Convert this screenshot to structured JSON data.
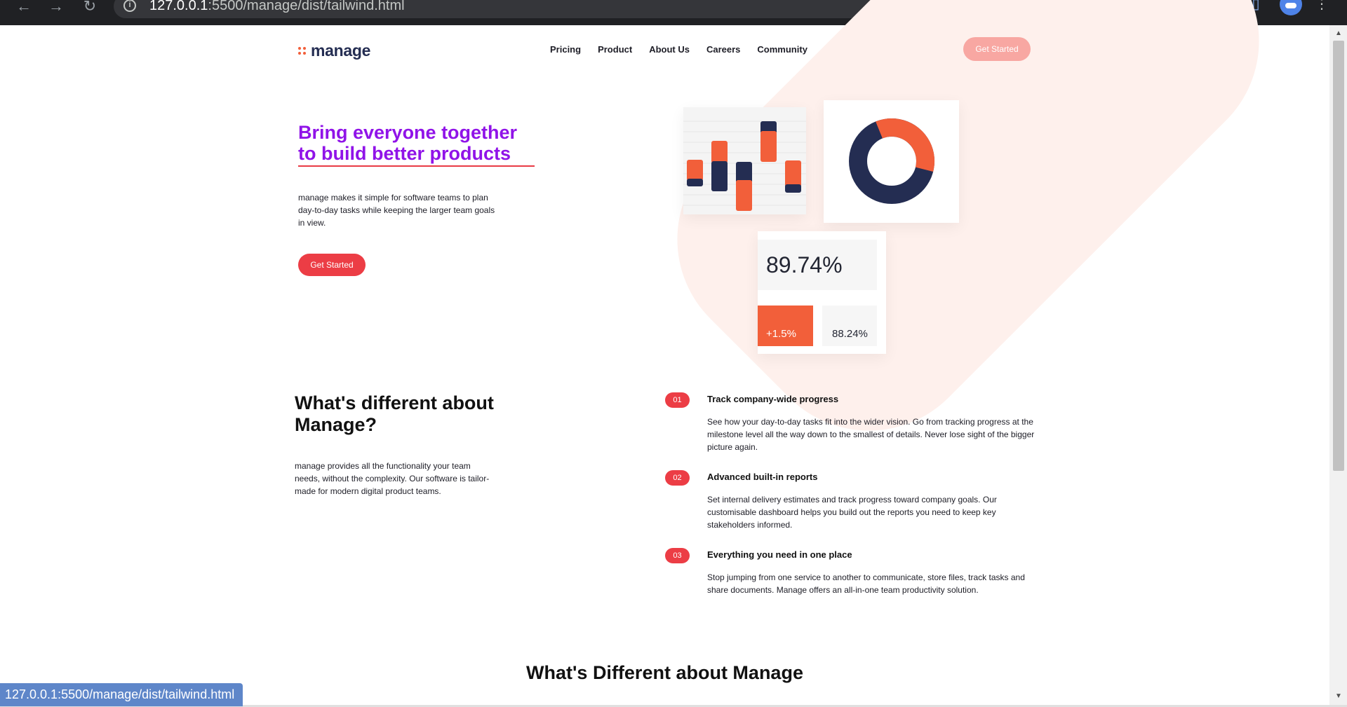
{
  "browser": {
    "url_host": "127.0.0.1",
    "url_path": ":5500/manage/dist/tailwind.html",
    "ext_badge": "{≡}",
    "status_url": "127.0.0.1:5500/manage/dist/tailwind.html"
  },
  "header": {
    "logo": "manage",
    "nav": [
      "Pricing",
      "Product",
      "About Us",
      "Careers",
      "Community"
    ],
    "cta_label": "Get Started"
  },
  "hero": {
    "title": "Bring everyone together to build better products",
    "description": "manage makes it simple for software teams to plan day-to-day tasks while keeping the larger team goals in view.",
    "cta_label": "Get Started"
  },
  "dashboard": {
    "main_stat": "89.74%",
    "change": "+1.5%",
    "secondary_stat": "88.24%",
    "colors": {
      "orange": "#f25f3a",
      "navy": "#242d52"
    },
    "donut_orange_fraction": 0.35
  },
  "features": {
    "title": "What's different about Manage?",
    "description": "manage provides all the functionality your team needs, without the complexity. Our software is tailor-made for modern digital product teams.",
    "items": [
      {
        "number": "01",
        "title": "Track company-wide progress",
        "description": "See how your day-to-day tasks fit into the wider vision. Go from tracking progress at the milestone level all the way down to the smallest of details. Never lose sight of the bigger picture again."
      },
      {
        "number": "02",
        "title": "Advanced built-in reports",
        "description": "Set internal delivery estimates and track progress toward company goals. Our customisable dashboard helps you build out the reports you need to keep key stakeholders informed."
      },
      {
        "number": "03",
        "title": "Everything you need in one place",
        "description": "Stop jumping from one service to another to communicate, store files, track tasks and share documents. Manage offers an all-in-one team productivity solution."
      }
    ]
  },
  "section2": {
    "title": "What's Different about Manage"
  },
  "colors": {
    "accent": "#ec3d45",
    "purple": "#9013e8",
    "peach": "#fef0ec"
  }
}
